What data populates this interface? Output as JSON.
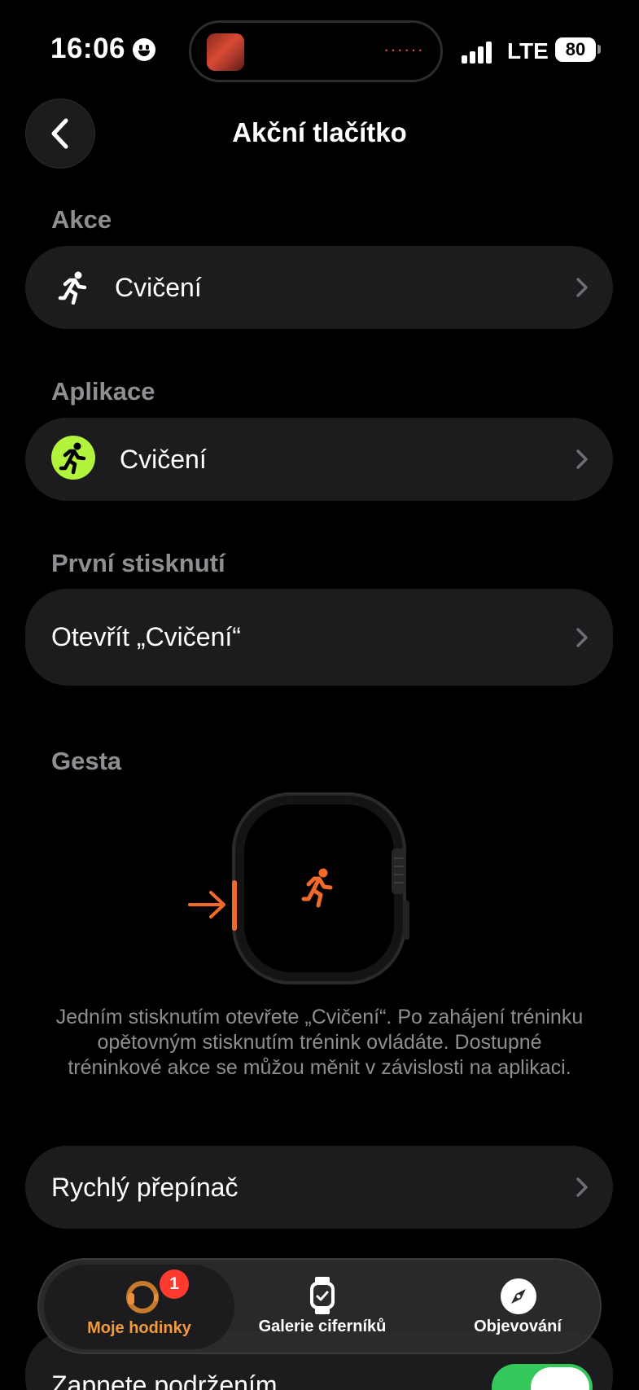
{
  "status_bar": {
    "time": "16:06",
    "network": "LTE",
    "battery": "80"
  },
  "header": {
    "title": "Akční tlačítko"
  },
  "sections": {
    "action": {
      "header": "Akce",
      "value": "Cvičení",
      "icon": "figure-run-icon"
    },
    "app": {
      "header": "Aplikace",
      "value": "Cvičení",
      "icon": "workout-app-icon",
      "icon_color": "#b2f33c"
    },
    "first_press": {
      "header": "První stisknutí",
      "value": "Otevřít „Cvičení“"
    },
    "gestures": {
      "header": "Gesta",
      "description": "Jedním stisknutím otevřete „Cvičení“. Po zahájení tréninku opětovným stisknutím trénink ovládáte. Dostupné tréninkové akce se můžou měnit v závislosti na aplikaci.",
      "accent_color": "#f26a2a"
    },
    "quick_switch": {
      "label": "Rychlý přepínač"
    },
    "hold_toggle": {
      "label": "Zapnete podržením",
      "on": true
    }
  },
  "tabbar": {
    "tabs": [
      {
        "label": "Moje hodinky",
        "icon": "watch-icon",
        "active": true,
        "badge": "1"
      },
      {
        "label": "Galerie ciferníků",
        "icon": "watch-face-gallery-icon",
        "active": false
      },
      {
        "label": "Objevování",
        "icon": "compass-icon",
        "active": false
      }
    ]
  }
}
